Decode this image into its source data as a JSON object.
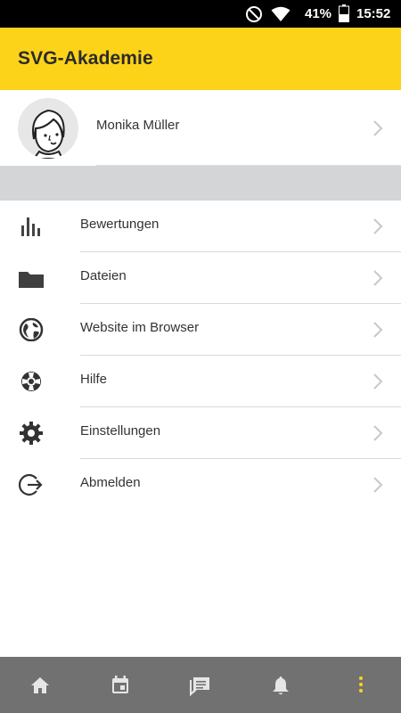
{
  "status_bar": {
    "battery_percent": "41%",
    "time": "15:52",
    "icons": [
      "do-not-disturb-icon",
      "wifi-icon",
      "battery-icon"
    ]
  },
  "app_bar": {
    "title": "SVG-Akademie",
    "background_color": "#fdd31a"
  },
  "profile": {
    "name": "Monika Müller"
  },
  "menu": {
    "items": [
      {
        "label": "Bewertungen",
        "icon": "bar-chart-icon"
      },
      {
        "label": "Dateien",
        "icon": "folder-icon"
      },
      {
        "label": "Website im Browser",
        "icon": "globe-icon"
      },
      {
        "label": "Hilfe",
        "icon": "lifebuoy-icon"
      },
      {
        "label": "Einstellungen",
        "icon": "gear-icon"
      },
      {
        "label": "Abmelden",
        "icon": "logout-icon"
      }
    ]
  },
  "bottom_nav": {
    "items": [
      {
        "icon": "home-icon"
      },
      {
        "icon": "calendar-icon"
      },
      {
        "icon": "chat-icon"
      },
      {
        "icon": "bell-icon"
      },
      {
        "icon": "more-vertical-icon",
        "active": true
      }
    ],
    "background_color": "#717171",
    "active_color": "#fdd31a",
    "inactive_color": "#e6e6e6"
  }
}
